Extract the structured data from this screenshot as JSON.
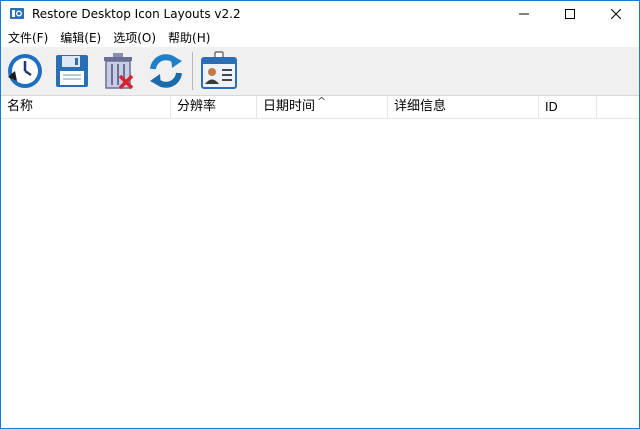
{
  "window": {
    "title": "Restore Desktop Icon Layouts v2.2",
    "app_icon": "app-logo-icon",
    "controls": [
      "minimize-icon",
      "maximize-icon",
      "close-icon"
    ]
  },
  "menubar": {
    "items": [
      {
        "label": "文件(F)"
      },
      {
        "label": "编辑(E)"
      },
      {
        "label": "选项(O)"
      },
      {
        "label": "帮助(H)"
      }
    ]
  },
  "toolbar": {
    "buttons": [
      {
        "icon": "restore-clock-icon"
      },
      {
        "icon": "save-floppy-icon"
      },
      {
        "icon": "delete-trash-icon"
      },
      {
        "icon": "refresh-icon"
      },
      {
        "icon": "about-id-card-icon"
      }
    ]
  },
  "list": {
    "columns": [
      {
        "label": "名称"
      },
      {
        "label": "分辨率"
      },
      {
        "label": "日期时间"
      },
      {
        "label": "详细信息"
      },
      {
        "label": "ID"
      }
    ],
    "sort_indicator": "^",
    "rows": []
  },
  "colors": {
    "border": "#1a7ad4",
    "toolbar_bg": "#f0f0f0",
    "accent_blue": "#1e6fbf"
  }
}
